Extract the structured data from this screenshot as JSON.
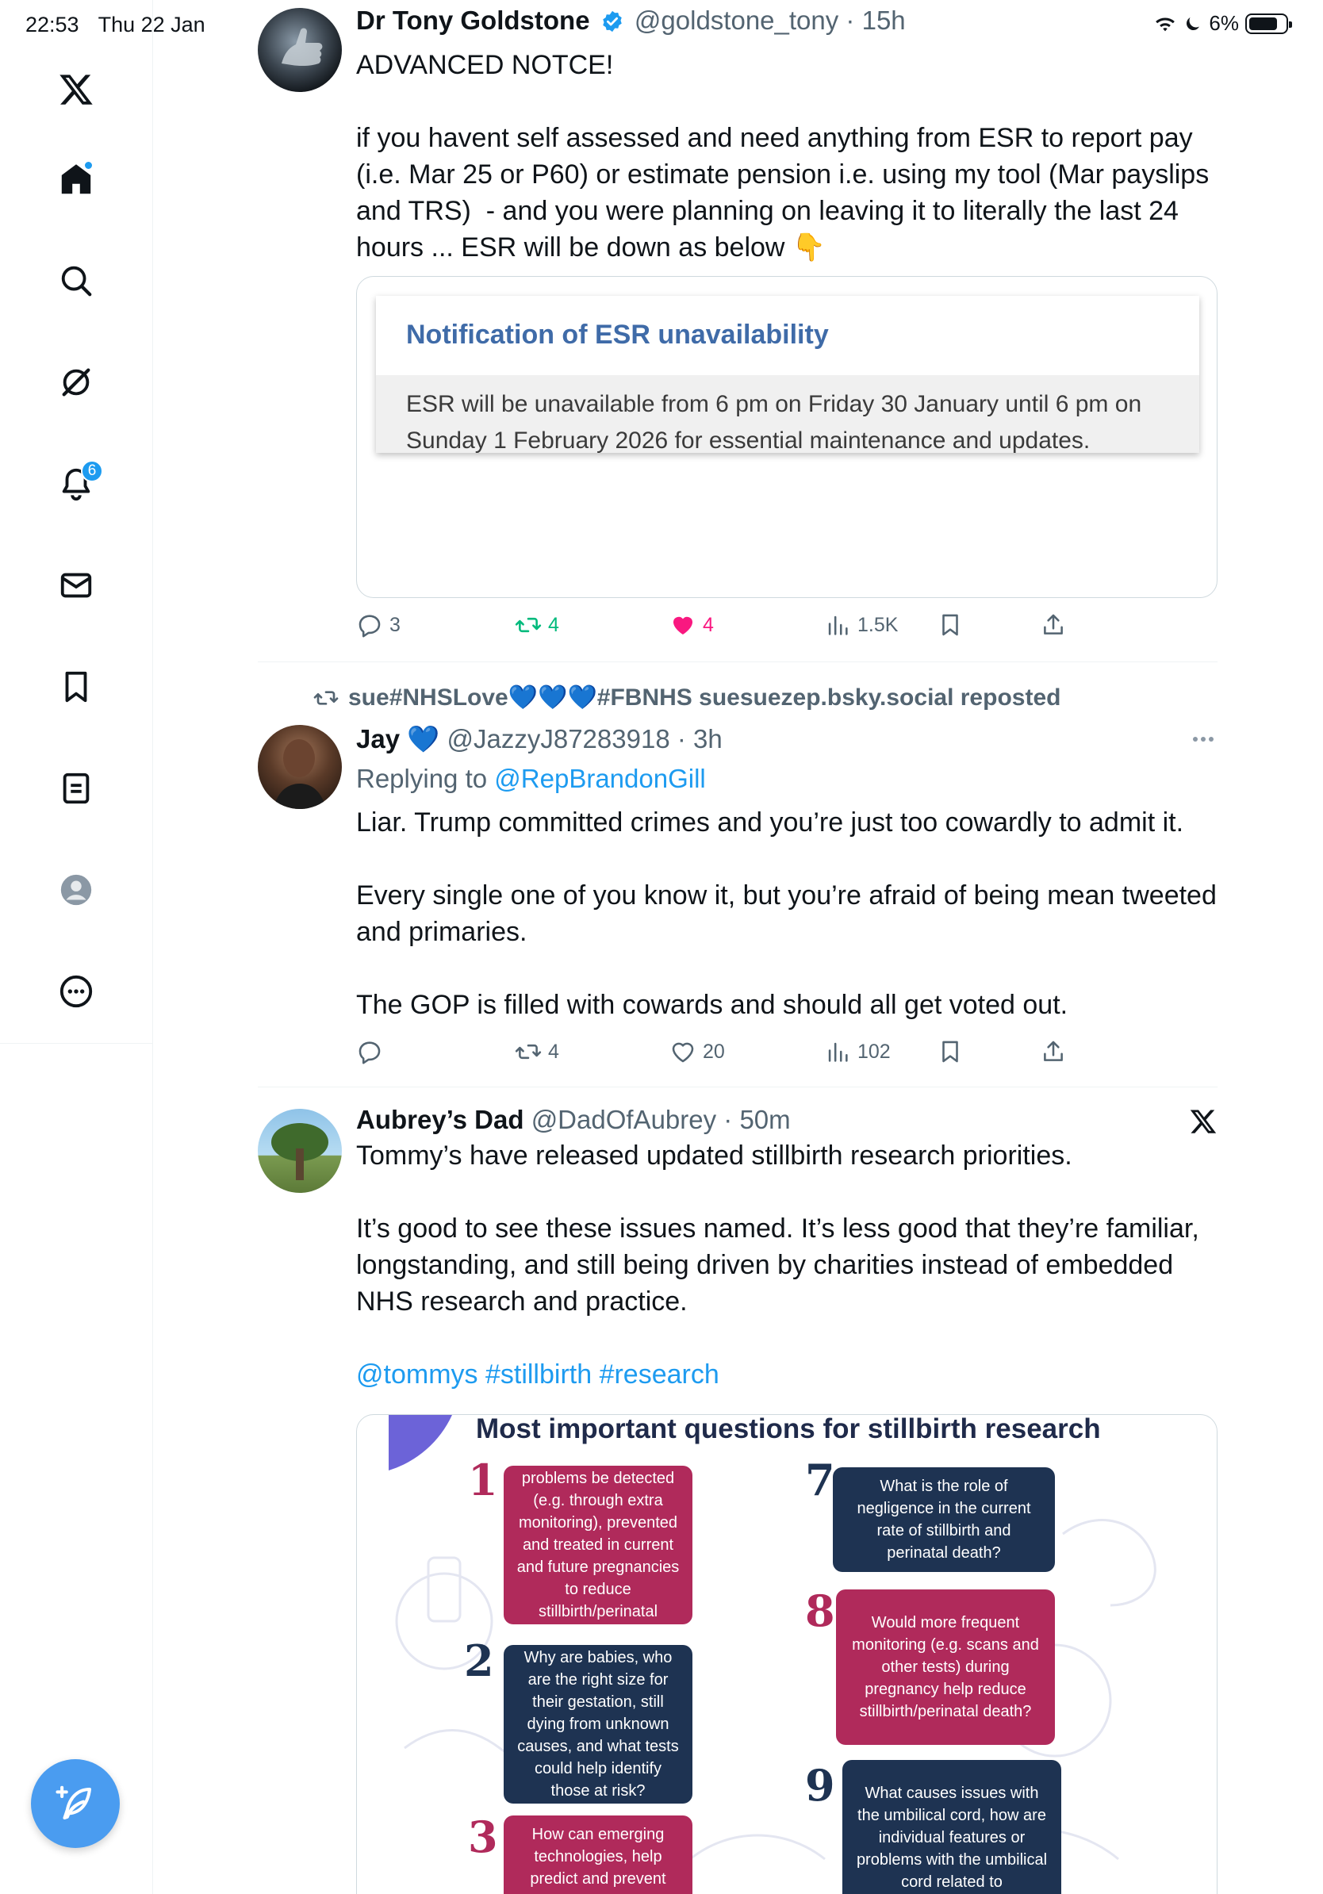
{
  "status": {
    "time": "22:53",
    "date": "Thu 22 Jan",
    "battery": "6%"
  },
  "nav": {
    "notifications_count": "6"
  },
  "tweets": [
    {
      "author": "Dr Tony Goldstone",
      "handle": "@goldstone_tony",
      "time": "15h",
      "text": "ADVANCED NOTCE!\n\nif you havent self assessed and need anything from ESR to report pay (i.e. Mar 25 or P60) or estimate pension i.e. using my tool (Mar payslips and TRS)  - and you were planning on leaving it to literally the last 24 hours ... ESR will be down as below 👇",
      "card_title": "Notification of ESR unavailability",
      "card_text": "ESR will be unavailable from 6 pm on Friday 30 January until 6 pm on Sunday 1 February 2026 for essential maintenance and updates.",
      "replies": "3",
      "reposts": "4",
      "likes": "4",
      "views": "1.5K"
    },
    {
      "repost_context": "sue#NHSLove💙💙💙#FBNHS suesuezep.bsky.social reposted",
      "author": "Jay 💙",
      "handle": "@JazzyJ87283918",
      "time": "3h",
      "replying_prefix": "Replying to",
      "replying_to": "@RepBrandonGill",
      "text": "Liar. Trump committed crimes and you’re just too cowardly to admit it.\n\nEvery single one of you know it, but you’re afraid of being mean tweeted and primaries.\n\nThe GOP is filled with cowards and should all get voted out.",
      "replies": "",
      "reposts": "4",
      "likes": "20",
      "views": "102"
    },
    {
      "author": "Aubrey’s Dad",
      "handle": "@DadOfAubrey",
      "time": "50m",
      "text": "Tommy’s have released updated stillbirth research priorities.\n\nIt’s good to see these issues named. It’s less good that they’re familiar, longstanding, and still being driven by charities instead of embedded NHS research and practice.",
      "tags": "@tommys #stillbirth #research",
      "infographic": {
        "title": "Most important questions for stillbirth research",
        "questions": [
          {
            "num": "1",
            "text": "How can placental problems be detected (e.g. through extra monitoring), prevented and treated in current and future pregnancies to reduce stillbirth/perinatal death?"
          },
          {
            "num": "2",
            "text": "Why are babies, who are the right size for their gestation, still dying from unknown causes, and what tests could help identify those at risk?"
          },
          {
            "num": "3",
            "text": "How can emerging technologies, help predict and prevent stillbirth and perinatal"
          },
          {
            "num": "7",
            "text": "What is the role of negligence in the current rate of stillbirth and perinatal death?"
          },
          {
            "num": "8",
            "text": "Would more frequent monitoring (e.g. scans and other tests) during pregnancy help reduce stillbirth/perinatal death?"
          },
          {
            "num": "9",
            "text": "What causes issues with the umbilical cord, how are individual features or problems with the umbilical cord related to"
          }
        ]
      }
    }
  ],
  "colors": {
    "accent": "#1d9bf0",
    "like": "#f91880",
    "repost": "#00ba7c",
    "pink_box": "#b02a5b",
    "navy_box": "#1e3352"
  }
}
